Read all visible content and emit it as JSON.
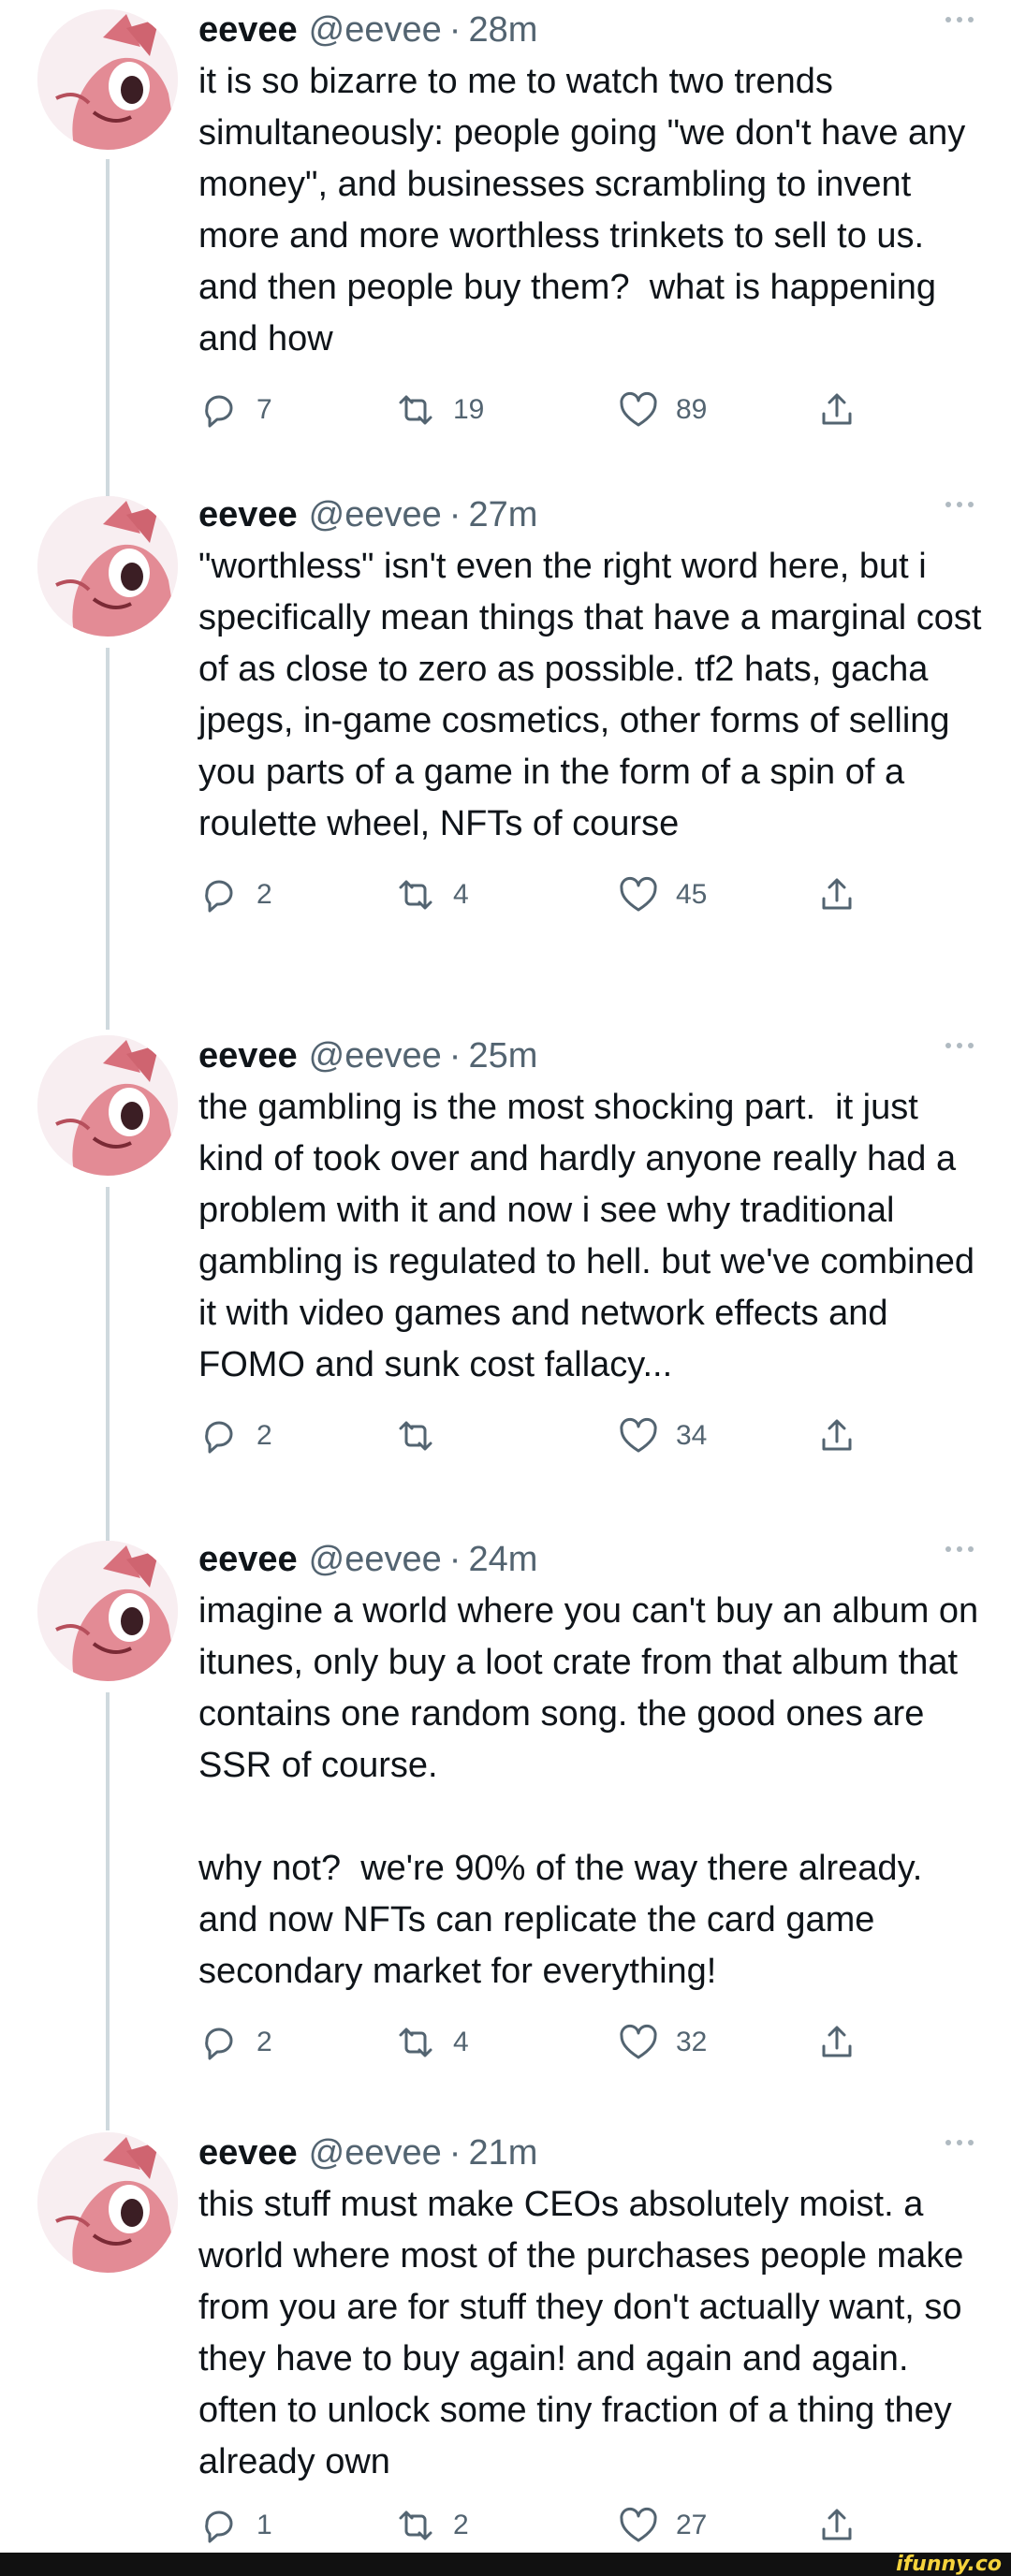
{
  "colors": {
    "text": "#0f1419",
    "muted": "#536471",
    "thread_line": "#cfd9de",
    "footer_bg": "#111111",
    "watermark": "#f6d33c"
  },
  "tweets": [
    {
      "name": "eevee",
      "handle": "@eevee",
      "separator": "·",
      "time": "28m",
      "text": "it is so bizarre to me to watch two trends simultaneously: people going \"we don't have any money\", and businesses scrambling to invent more and more worthless trinkets to sell to us.  and then people buy them?  what is happening and how",
      "replies": "7",
      "retweets": "19",
      "likes": "89"
    },
    {
      "name": "eevee",
      "handle": "@eevee",
      "separator": "·",
      "time": "27m",
      "text": "\"worthless\" isn't even the right word here, but i specifically mean things that have a marginal cost of as close to zero as possible. tf2 hats, gacha jpegs, in-game cosmetics, other forms of selling you parts of a game in the form of a spin of a roulette wheel, NFTs of course",
      "replies": "2",
      "retweets": "4",
      "likes": "45"
    },
    {
      "name": "eevee",
      "handle": "@eevee",
      "separator": "·",
      "time": "25m",
      "text": "the gambling is the most shocking part.  it just kind of took over and hardly anyone really had a problem with it and now i see why traditional gambling is regulated to hell. but we've combined it with video games and network effects and FOMO and sunk cost fallacy...",
      "replies": "2",
      "retweets": "",
      "likes": "34"
    },
    {
      "name": "eevee",
      "handle": "@eevee",
      "separator": "·",
      "time": "24m",
      "text": "imagine a world where you can't buy an album on itunes, only buy a loot crate from that album that contains one random song. the good ones are SSR of course.\n\nwhy not?  we're 90% of the way there already.  and now NFTs can replicate the card game secondary market for everything!",
      "replies": "2",
      "retweets": "4",
      "likes": "32"
    },
    {
      "name": "eevee",
      "handle": "@eevee",
      "separator": "·",
      "time": "21m",
      "text": "this stuff must make CEOs absolutely moist. a world where most of the purchases people make from you are for stuff they don't actually want, so they have to buy again! and again and again.  often to unlock some tiny fraction of a thing they already own",
      "replies": "1",
      "retweets": "2",
      "likes": "27"
    }
  ],
  "icons": {
    "reply": "reply-icon",
    "retweet": "retweet-icon",
    "like": "heart-icon",
    "share": "share-icon",
    "more": "more-icon"
  },
  "watermark": "ifunny.co"
}
